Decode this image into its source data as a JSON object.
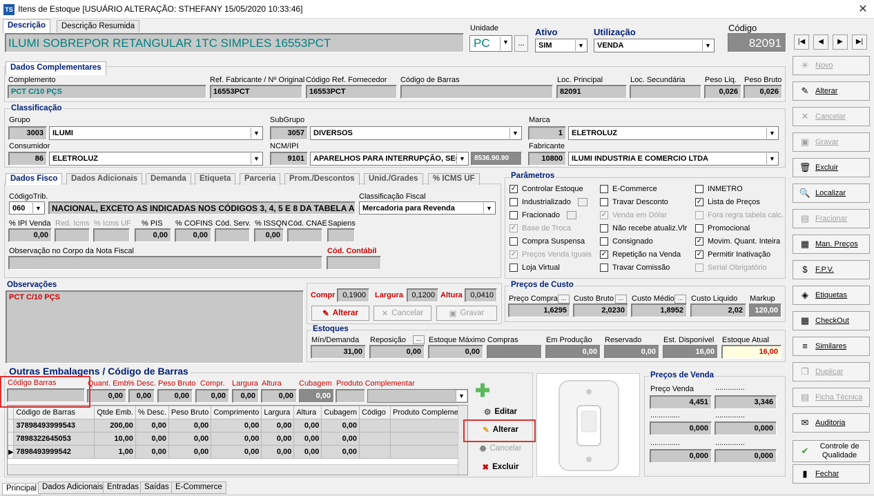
{
  "window": {
    "icon_text": "TS",
    "title": "Itens de Estoque  [USUÁRIO ALTERAÇÃO: STHEFANY  15/05/2020 10:33:46]",
    "close": "✕"
  },
  "header": {
    "tabs": [
      "Descrição",
      "Descrição Resumida"
    ],
    "descricao": "ILUMI SOBREPOR RETANGULAR 1TC SIMPLES  16553PCT",
    "unidade_label": "Unidade",
    "unidade": "PC",
    "unidade_dots": "...",
    "ativo_label": "Ativo",
    "ativo": "SIM",
    "utilizacao_label": "Utilização",
    "utilizacao": "VENDA",
    "codigo_label": "Código",
    "codigo": "82091"
  },
  "complementares": {
    "title": "Dados Complementares",
    "complemento_label": "Complemento",
    "complemento": "PCT C/10 PÇS",
    "ref_fabricante_label": "Ref. Fabricante / Nº Original",
    "ref_fabricante": "16553PCT",
    "cod_ref_fornecedor_label": "Código Ref. Fornecedor",
    "cod_ref_fornecedor": "16553PCT",
    "cod_barras_label": "Código de Barras",
    "cod_barras": "",
    "loc_principal_label": "Loc. Principal",
    "loc_principal": "82091",
    "loc_secundaria_label": "Loc. Secundária",
    "loc_secundaria": "",
    "peso_liq_label": "Peso Liq.",
    "peso_liq": "0,026",
    "peso_bruto_label": "Peso Bruto",
    "peso_bruto": "0,026"
  },
  "classificacao": {
    "title": "Classificação",
    "grupo_label": "Grupo",
    "grupo_cod": "3003",
    "grupo": "ILUMI",
    "subgrupo_label": "SubGrupo",
    "subgrupo_cod": "3057",
    "subgrupo": "DIVERSOS",
    "marca_label": "Marca",
    "marca_cod": "1",
    "marca": "ELETROLUZ",
    "consumidor_label": "Consumidor",
    "consumidor_cod": "86",
    "consumidor": "ELETROLUZ",
    "ncm_label": "NCM/IPI",
    "ncm_cod": "9101",
    "ncm": "APARELHOS PARA INTERRUPÇÃO, SECC",
    "ncm_num": "8536.90.90",
    "fabricante_label": "Fabricante",
    "fabricante_cod": "10800",
    "fabricante": "ILUMI INDUSTRIA E COMERCIO LTDA"
  },
  "fisco": {
    "tabs": [
      "Dados Fisco",
      "Dados Adicionais",
      "Demanda",
      "Etiqueta",
      "Parceria",
      "Prom./Descontos",
      "Unid./Grades",
      "% ICMS UF"
    ],
    "codtrib_label": "CódigoTrib.",
    "codtrib": "060",
    "codtrib_desc": "NACIONAL, EXCETO AS INDICADAS NOS CÓDIGOS 3, 4, 5 E 8 DA TABELA A",
    "classfiscal_label": "Classificação Fiscal",
    "classfiscal": "Mercadoria para Revenda",
    "ipi_label": "% IPI Venda",
    "ipi": "0,00",
    "red_icms_label": "Red. Icms",
    "icms_uf_label": "% Icms UF",
    "pis_label": "% PIS",
    "pis": "0,00",
    "cofins_label": "% COFINS",
    "cofins": "0,00",
    "cod_serv_label": "Cód. Serv.",
    "issqn_label": "% ISSQN",
    "issqn": "0,00",
    "cod_cnae_label": "Cód. CNAE",
    "sapiens_label": "Sapiens",
    "obs_nf_label": "Observação no Corpo da Nota Fiscal",
    "cod_contabil_label": "Cód. Contábil"
  },
  "parametros": {
    "title": "Parâmetros",
    "items": [
      {
        "label": "Controlar Estoque",
        "checked": "✓",
        "disabled": false
      },
      {
        "label": "Industrializado",
        "checked": "",
        "disabled": false,
        "mini": true
      },
      {
        "label": "Fracionado",
        "checked": "",
        "disabled": false,
        "mini": true
      },
      {
        "label": "Base de Troca",
        "checked": "✓",
        "disabled": true
      },
      {
        "label": "Compra Suspensa",
        "checked": "",
        "disabled": false
      },
      {
        "label": "Preços Venda Iguais",
        "checked": "✓",
        "disabled": true
      },
      {
        "label": "Loja Virtual",
        "checked": "",
        "disabled": false
      },
      {
        "label": "E-Commerce",
        "checked": "",
        "disabled": false
      },
      {
        "label": "Travar Desconto",
        "checked": "",
        "disabled": false
      },
      {
        "label": "Venda em Dólar",
        "checked": "✓",
        "disabled": true
      },
      {
        "label": "Não recebe atualiz.Vlr",
        "checked": "",
        "disabled": false
      },
      {
        "label": "Consignado",
        "checked": "",
        "disabled": false
      },
      {
        "label": "Repetição na Venda",
        "checked": "✓",
        "disabled": false
      },
      {
        "label": "Travar Comissão",
        "checked": "",
        "disabled": false
      },
      {
        "label": "INMETRO",
        "checked": "",
        "disabled": false
      },
      {
        "label": "Lista de Preços",
        "checked": "✓",
        "disabled": false
      },
      {
        "label": "Fora regra tabela calc.",
        "checked": "",
        "disabled": true
      },
      {
        "label": "Promocional",
        "checked": "",
        "disabled": false
      },
      {
        "label": "Movim. Quant. Inteira",
        "checked": "✓",
        "disabled": false
      },
      {
        "label": "Permitir Inativação",
        "checked": "✓",
        "disabled": false
      },
      {
        "label": "Serial Obrigatório",
        "checked": "",
        "disabled": true
      }
    ]
  },
  "observacoes": {
    "title": "Observações",
    "text": "PCT C/10 PÇS"
  },
  "dimensoes": {
    "compr_label": "Compr",
    "compr": "0,1900",
    "largura_label": "Largura",
    "largura": "0,1200",
    "altura_label": "Altura",
    "altura": "0,0410",
    "alterar": "Alterar",
    "cancelar": "Cancelar",
    "gravar": "Gravar"
  },
  "precos_custo": {
    "title": "Preços de Custo",
    "compra_label": "Preço Compra",
    "compra": "1,6295",
    "bruto_label": "Custo Bruto",
    "bruto": "2,0230",
    "medio_label": "Custo Médio",
    "medio": "1,8952",
    "liquido_label": "Custo Liquido",
    "liquido": "2,02",
    "markup_label": "Markup",
    "markup": "120,00"
  },
  "estoques": {
    "title": "Estoques",
    "min_label": "Mín/Demanda",
    "min": "31,00",
    "reposicao_label": "Reposição",
    "reposicao": "0,00",
    "maximo_label": "Estoque Máximo",
    "maximo": "0,00",
    "compras_label": "Compras",
    "compras": "",
    "producao_label": "Em Produção",
    "producao": "0,00",
    "reservado_label": "Reservado",
    "reservado": "0,00",
    "disponivel_label": "Est. Disponível",
    "disponivel": "16,00",
    "atual_label": "Estoque Atual",
    "atual": "16,00"
  },
  "embalagens": {
    "title": "Outras Embalagens / Código de Barras",
    "cod_barras_label": "Código Barras",
    "quant_label": "Quant. Emb.",
    "quant": "0,00",
    "desc_label": "% Desc.",
    "desc": "0,00",
    "peso_label": "Peso Bruto",
    "peso": "0,00",
    "compr_label": "Compr.",
    "compr": "0,00",
    "largura_label": "Largura",
    "largura": "0,00",
    "altura_label": "Altura",
    "altura": "0,00",
    "cubagem_label": "Cubagem",
    "cubagem": "0,00",
    "produto_label": "Produto Complementar",
    "columns": [
      "Código de Barras",
      "Qtde Emb.",
      "% Desc.",
      "Peso Bruto",
      "Comprimento",
      "Largura",
      "Altura",
      "Cubagem",
      "Código",
      "Produto Complement"
    ],
    "rows": [
      [
        "37898493999543",
        "200,00",
        "0,00",
        "0,00",
        "0,00",
        "0,00",
        "0,00",
        "0,00",
        "",
        ""
      ],
      [
        "7898322645053",
        "10,00",
        "0,00",
        "0,00",
        "0,00",
        "0,00",
        "0,00",
        "0,00",
        "",
        ""
      ],
      [
        "7898493999542",
        "1,00",
        "0,00",
        "0,00",
        "0,00",
        "0,00",
        "0,00",
        "0,00",
        "",
        ""
      ]
    ],
    "current_marker": "▶",
    "editar": "Editar",
    "alterar": "Alterar",
    "cancelar": "Cancelar",
    "excluir": "Excluir"
  },
  "precos_venda": {
    "title": "Preços de Venda",
    "v1_label": "Preço Venda",
    "v1": "4,451",
    "v2_label": "..............",
    "v2": "3,346",
    "v3_label": "..............",
    "v3": "0,000",
    "v4_label": "..............",
    "v4": "0,000",
    "v5_label": "..............",
    "v5": "0,000",
    "v6_label": "..............",
    "v6": "0,000"
  },
  "side_buttons": [
    {
      "label": "Novo",
      "icon": "✳",
      "disabled": true
    },
    {
      "label": "Alterar",
      "icon": "✎",
      "disabled": false
    },
    {
      "label": "Cancelar",
      "icon": "✕",
      "disabled": true
    },
    {
      "label": "Gravar",
      "icon": "▣",
      "disabled": true
    },
    {
      "label": "Excluir",
      "icon": "🗑",
      "disabled": false
    },
    {
      "label": "Localizar",
      "icon": "🔍",
      "disabled": false
    },
    {
      "label": "Fracionar",
      "icon": "▤",
      "disabled": true
    },
    {
      "label": "Man. Preços",
      "icon": "▦",
      "disabled": false
    },
    {
      "label": "F.P.V.",
      "icon": "$",
      "disabled": false
    },
    {
      "label": "Etiquetas",
      "icon": "◈",
      "disabled": false
    },
    {
      "label": "CheckOut",
      "icon": "▦",
      "disabled": false
    },
    {
      "label": "Similares",
      "icon": "≡",
      "disabled": false
    },
    {
      "label": "Duplicar",
      "icon": "❐",
      "disabled": true
    },
    {
      "label": "Ficha Técnica",
      "icon": "▤",
      "disabled": true
    },
    {
      "label": "Auditoria",
      "icon": "✉",
      "disabled": false
    },
    {
      "label": "Controle de Qualidade",
      "icon": "✔",
      "disabled": false
    },
    {
      "label": "Fechar",
      "icon": "▮",
      "disabled": false
    }
  ],
  "nav": [
    "|◀",
    "◀",
    "▶",
    "▶|"
  ],
  "bottom_tabs": [
    "Principal",
    "Dados Adicionais",
    "Entradas",
    "Saídas",
    "E-Commerce"
  ],
  "colors": {
    "group_title": "#00207a",
    "required_label": "#d00000",
    "highlight": "#e03030"
  }
}
